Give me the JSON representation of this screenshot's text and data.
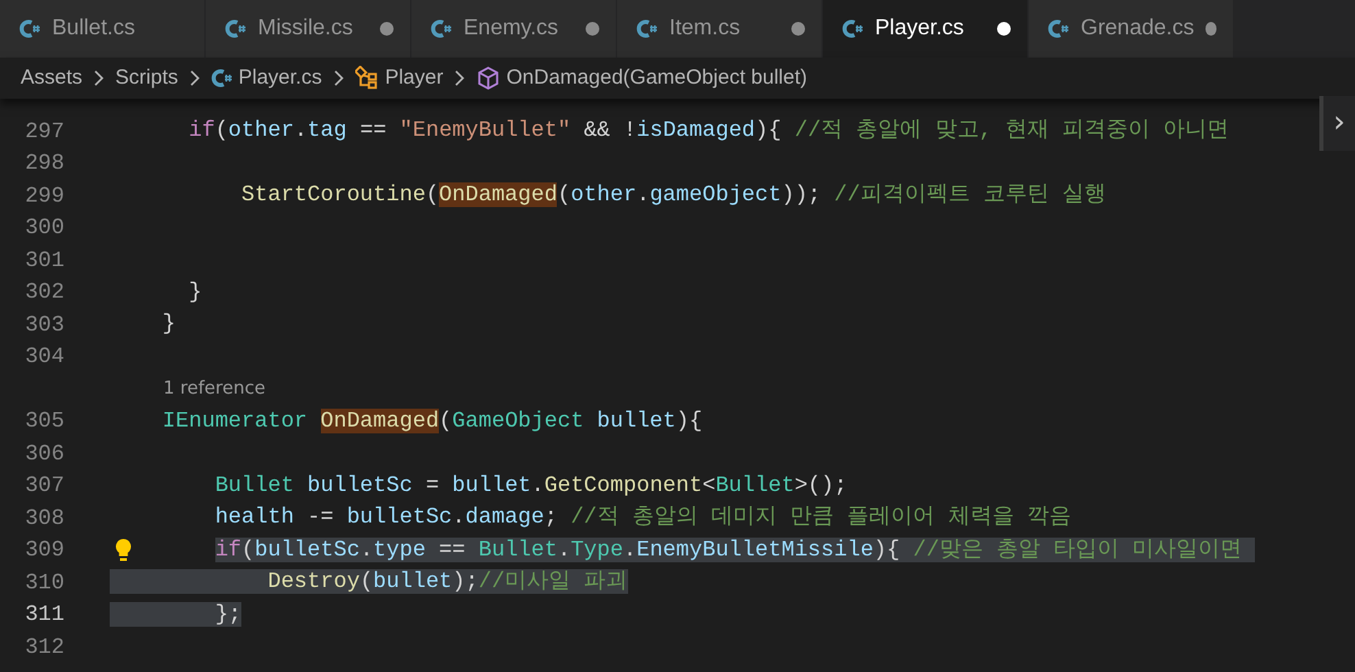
{
  "tabs": [
    {
      "label": "Bullet.cs",
      "modified": false,
      "selected": false
    },
    {
      "label": "Missile.cs",
      "modified": true,
      "selected": false
    },
    {
      "label": "Enemy.cs",
      "modified": true,
      "selected": false
    },
    {
      "label": "Item.cs",
      "modified": true,
      "selected": false
    },
    {
      "label": "Player.cs",
      "modified": true,
      "selected": true
    },
    {
      "label": "Grenade.cs",
      "modified": true,
      "selected": false
    }
  ],
  "breadcrumbs": [
    {
      "label": "Assets",
      "kind": "folder"
    },
    {
      "label": "Scripts",
      "kind": "folder"
    },
    {
      "label": "Player.cs",
      "kind": "file"
    },
    {
      "label": "Player",
      "kind": "class"
    },
    {
      "label": "OnDamaged(GameObject bullet)",
      "kind": "method"
    }
  ],
  "peek_toggle": "›",
  "lines": [
    {
      "number": "297",
      "current": false,
      "tokens": [
        {
          "text": "      if",
          "kind": "keyword"
        },
        {
          "text": "(",
          "kind": "punct"
        },
        {
          "text": "other",
          "kind": "var"
        },
        {
          "text": ".",
          "kind": "punct"
        },
        {
          "text": "tag",
          "kind": "var"
        },
        {
          "text": " == ",
          "kind": "punct"
        },
        {
          "text": "\"EnemyBullet\"",
          "kind": "string"
        },
        {
          "text": " && !",
          "kind": "punct"
        },
        {
          "text": "isDamaged",
          "kind": "var"
        },
        {
          "text": "){ ",
          "kind": "punct"
        },
        {
          "text": "//적 총알에 맞고, 현재 피격중이 아니면",
          "kind": "comment"
        }
      ]
    },
    {
      "number": "298",
      "current": false
    },
    {
      "number": "299",
      "current": false,
      "tokens": [
        {
          "text": "          StartCoroutine",
          "kind": "func"
        },
        {
          "text": "(",
          "kind": "punct"
        },
        {
          "text": "OnDamaged",
          "kind": "func",
          "highlight": true
        },
        {
          "text": "(",
          "kind": "punct"
        },
        {
          "text": "other",
          "kind": "var"
        },
        {
          "text": ".",
          "kind": "punct"
        },
        {
          "text": "gameObject",
          "kind": "var"
        },
        {
          "text": ")); ",
          "kind": "punct"
        },
        {
          "text": "//피격이펙트 코루틴 실행",
          "kind": "comment"
        }
      ]
    },
    {
      "number": "300",
      "current": false
    },
    {
      "number": "301",
      "current": false
    },
    {
      "number": "302",
      "current": false,
      "tokens": [
        {
          "text": "      }",
          "kind": "punct"
        }
      ]
    },
    {
      "number": "303",
      "current": false,
      "tokens": [
        {
          "text": "    }",
          "kind": "punct"
        }
      ]
    },
    {
      "number": "304",
      "current": false
    },
    {
      "codelens": "1 reference"
    },
    {
      "number": "305",
      "current": false,
      "tokens": [
        {
          "text": "    IEnumerator ",
          "kind": "type"
        },
        {
          "text": "OnDamaged",
          "kind": "func",
          "highlight": true
        },
        {
          "text": "(",
          "kind": "punct"
        },
        {
          "text": "GameObject",
          "kind": "type"
        },
        {
          "text": " bullet",
          "kind": "var"
        },
        {
          "text": "){",
          "kind": "punct"
        }
      ]
    },
    {
      "number": "306",
      "current": false
    },
    {
      "number": "307",
      "current": false,
      "tokens": [
        {
          "text": "        Bullet",
          "kind": "type"
        },
        {
          "text": " bulletSc",
          "kind": "var"
        },
        {
          "text": " = ",
          "kind": "punct"
        },
        {
          "text": "bullet",
          "kind": "var"
        },
        {
          "text": ".",
          "kind": "punct"
        },
        {
          "text": "GetComponent",
          "kind": "func"
        },
        {
          "text": "<",
          "kind": "punct"
        },
        {
          "text": "Bullet",
          "kind": "type"
        },
        {
          "text": ">();",
          "kind": "punct"
        }
      ]
    },
    {
      "number": "308",
      "current": false,
      "tokens": [
        {
          "text": "        health",
          "kind": "var"
        },
        {
          "text": " -= ",
          "kind": "punct"
        },
        {
          "text": "bulletSc",
          "kind": "var"
        },
        {
          "text": ".",
          "kind": "punct"
        },
        {
          "text": "damage",
          "kind": "var"
        },
        {
          "text": "; ",
          "kind": "punct"
        },
        {
          "text": "//적 총알의 데미지 만큼 플레이어 체력을 깍음",
          "kind": "comment"
        }
      ]
    },
    {
      "number": "309",
      "current": false,
      "selected": true,
      "indent_selected": false,
      "lightbulb": true,
      "tokens": [
        {
          "text": "        if",
          "kind": "keyword"
        },
        {
          "text": "(",
          "kind": "punct"
        },
        {
          "text": "bulletSc",
          "kind": "var"
        },
        {
          "text": ".",
          "kind": "punct"
        },
        {
          "text": "type",
          "kind": "var"
        },
        {
          "text": " == ",
          "kind": "punct"
        },
        {
          "text": "Bullet",
          "kind": "type"
        },
        {
          "text": ".",
          "kind": "punct"
        },
        {
          "text": "Type",
          "kind": "type"
        },
        {
          "text": ".",
          "kind": "punct"
        },
        {
          "text": "EnemyBulletMissile",
          "kind": "var"
        },
        {
          "text": "){ ",
          "kind": "punct"
        },
        {
          "text": "//맞은 총알 타입이 미사일이면 ",
          "kind": "comment"
        }
      ]
    },
    {
      "number": "310",
      "current": false,
      "selected": true,
      "indent_selected": true,
      "tokens": [
        {
          "text": "            Destroy",
          "kind": "func"
        },
        {
          "text": "(",
          "kind": "punct"
        },
        {
          "text": "bullet",
          "kind": "var"
        },
        {
          "text": ");",
          "kind": "punct"
        },
        {
          "text": "//미사일 파괴",
          "kind": "comment"
        }
      ]
    },
    {
      "number": "311",
      "current": true,
      "selected": true,
      "indent_selected": true,
      "tokens": [
        {
          "text": "        };",
          "kind": "punct"
        }
      ]
    },
    {
      "number": "312",
      "current": false
    }
  ]
}
